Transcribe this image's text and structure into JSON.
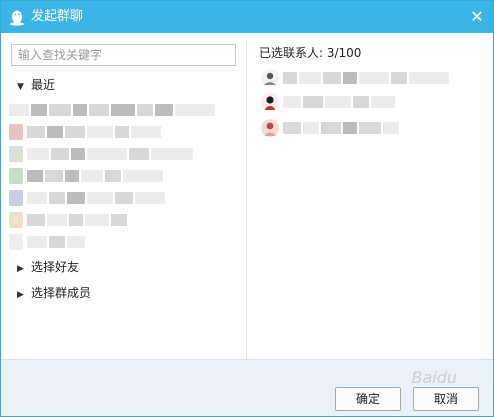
{
  "window": {
    "title": "发起群聊",
    "accent_color": "#3cb4e6"
  },
  "search": {
    "placeholder": "输入查找关键字",
    "value": ""
  },
  "tree": [
    {
      "label": "最近",
      "expanded": true
    },
    {
      "label": "选择好友",
      "expanded": false
    },
    {
      "label": "选择群成员",
      "expanded": false
    }
  ],
  "selected": {
    "title": "已选联系人: 3/100",
    "count": 3,
    "max": 100
  },
  "buttons": {
    "ok": "确定",
    "cancel": "取消"
  },
  "icons": {
    "title": "qq-penguin-icon",
    "close": "close-icon",
    "expanded": "triangle-down-icon",
    "collapsed": "triangle-right-icon"
  }
}
